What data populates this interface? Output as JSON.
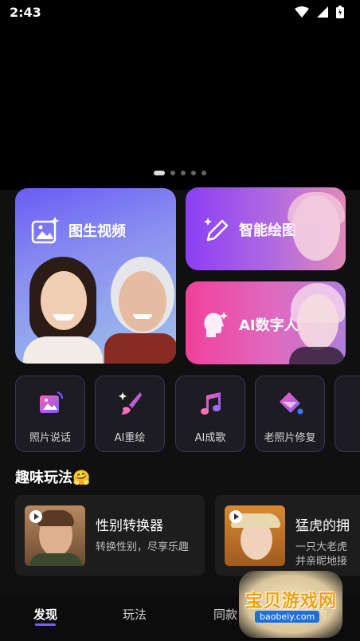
{
  "status_bar": {
    "time": "2:43"
  },
  "feature_cards": {
    "image_to_video": "图生视频",
    "smart_drawing": "智能绘图",
    "ai_digital_human": "AI数字人"
  },
  "tools": [
    {
      "label": "照片说话",
      "icon": "photo-talk-icon"
    },
    {
      "label": "AI重绘",
      "icon": "brush-icon"
    },
    {
      "label": "AI成歌",
      "icon": "music-note-icon"
    },
    {
      "label": "老照片修复",
      "icon": "paint-bucket-icon"
    }
  ],
  "fun_section": {
    "title": "趣味玩法🤗",
    "cards": [
      {
        "title": "性别转换器",
        "desc": "转换性别，尽享乐趣"
      },
      {
        "title": "猛虎的拥",
        "desc": "一只大老虎\n并亲昵地接"
      }
    ]
  },
  "bottom_nav": {
    "items": [
      "发现",
      "玩法",
      "同款",
      "我的"
    ],
    "active": "发现"
  },
  "watermark": {
    "text": "宝贝游戏网",
    "url": "baobeiy.com"
  },
  "colors": {
    "accent": "#7b5cff",
    "card_big_start": "#6a5cf5",
    "card_draw_start": "#8b3ff5",
    "card_human_start": "#f0409a"
  }
}
